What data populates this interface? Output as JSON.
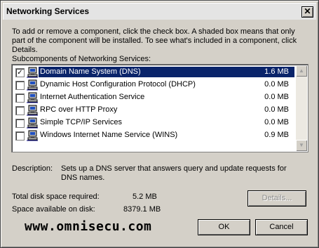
{
  "window": {
    "title": "Networking Services",
    "close_glyph": "✕"
  },
  "intro": "To add or remove a component, click the check box. A shaded box means that only part of the component will be installed. To see what's included in a component, click Details.",
  "subcomponents_label": "Subcomponents of Networking Services:",
  "components": [
    {
      "label": "Domain Name System (DNS)",
      "size": "1.6 MB",
      "checked": true,
      "selected": true
    },
    {
      "label": "Dynamic Host Configuration Protocol (DHCP)",
      "size": "0.0 MB",
      "checked": false,
      "selected": false
    },
    {
      "label": "Internet Authentication Service",
      "size": "0.0 MB",
      "checked": false,
      "selected": false
    },
    {
      "label": "RPC over HTTP Proxy",
      "size": "0.0 MB",
      "checked": false,
      "selected": false
    },
    {
      "label": "Simple TCP/IP Services",
      "size": "0.0 MB",
      "checked": false,
      "selected": false
    },
    {
      "label": "Windows Internet Name Service (WINS)",
      "size": "0.9 MB",
      "checked": false,
      "selected": false
    }
  ],
  "description": {
    "label": "Description:",
    "text": "Sets up a DNS server that answers query and update requests for DNS names."
  },
  "disk": {
    "required_label": "Total disk space required:",
    "required_value": "5.2 MB",
    "available_label": "Space available on disk:",
    "available_value": "8379.1 MB"
  },
  "buttons": {
    "details": "Details...",
    "ok": "OK",
    "cancel": "Cancel"
  },
  "watermark": "www.omnisecu.com",
  "colors": {
    "selection": "#0a246a",
    "dialog": "#d4d0c8"
  },
  "icons": {
    "component_icon": "network-computer-icon",
    "scroll_up": "scroll-up-icon",
    "scroll_down": "scroll-down-icon"
  }
}
